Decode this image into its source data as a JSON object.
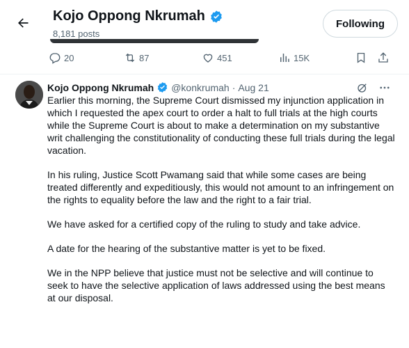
{
  "header": {
    "name": "Kojo Oppong Nkrumah",
    "posts": "8,181 posts",
    "follow_label": "Following"
  },
  "actions": {
    "replies": "20",
    "reposts": "87",
    "likes": "451",
    "views": "15K"
  },
  "tweet": {
    "author": "Kojo Oppong Nkrumah",
    "handle": "@konkrumah",
    "separator": "·",
    "date": "Aug 21",
    "paragraphs": [
      "Earlier this morning, the Supreme Court dismissed my injunction application in which I requested the apex court to order a halt to full trials at the high courts while the Supreme Court is about to make a determination on my substantive writ challenging the constitutionality of conducting these full trials during the legal vacation.",
      "In his ruling, Justice Scott Pwamang said that while some cases are being treated differently and expeditiously, this would not amount to an infringement on the rights to equality before the law and the right to a fair trial.",
      "We have asked for a certified copy of the ruling to study and take advice.",
      "A date for the hearing of the substantive matter is yet to be fixed.",
      "We in the NPP believe that justice must not be selective and will continue to seek to have the selective application of laws addressed using the best means at our disposal."
    ]
  },
  "colors": {
    "verified": "#1d9bf0",
    "muted": "#536471",
    "text": "#0f1419"
  }
}
